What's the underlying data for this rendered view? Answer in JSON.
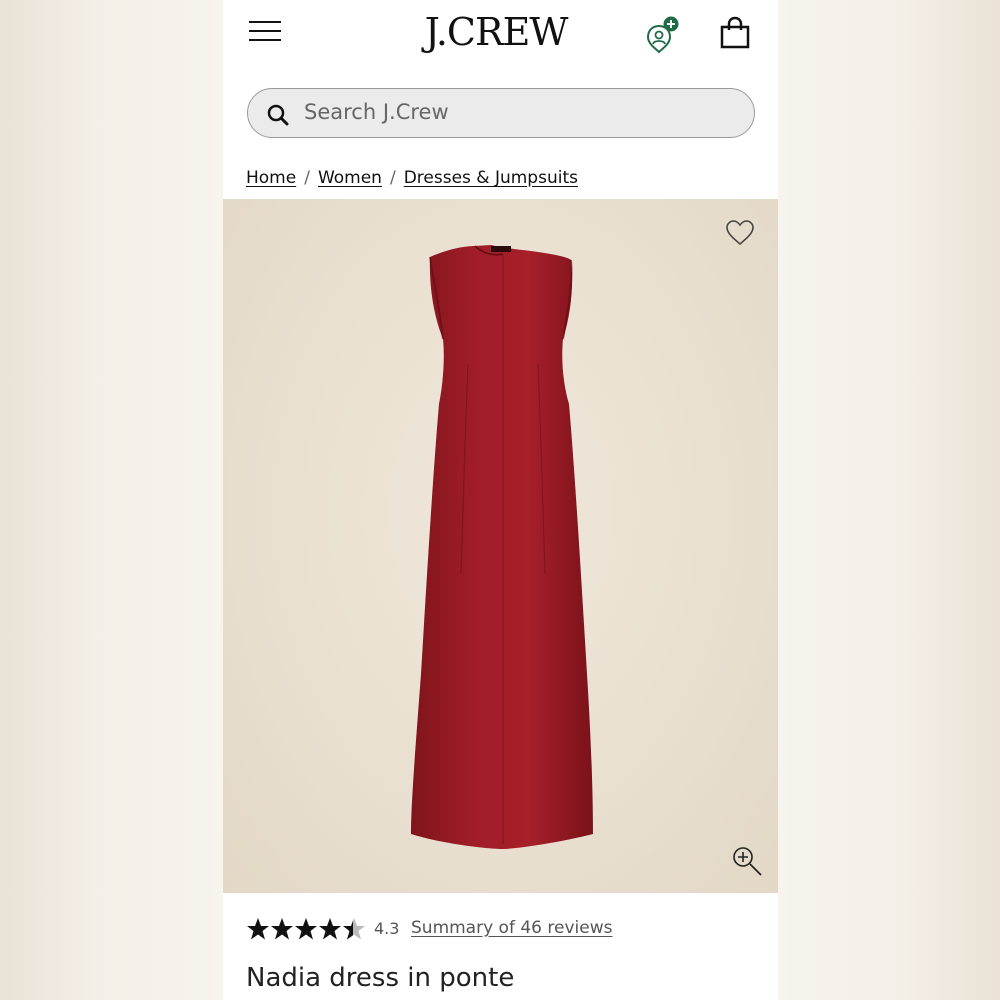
{
  "header": {
    "logo_text": "J.CREW",
    "menu_icon": "hamburger-menu-icon",
    "account_icon": "rewards-account-icon",
    "bag_icon": "shopping-bag-icon"
  },
  "search": {
    "placeholder": "Search J.Crew",
    "icon": "search-icon"
  },
  "breadcrumb": {
    "items": [
      "Home",
      "Women",
      "Dresses & Jumpsuits"
    ],
    "separator": "/"
  },
  "product": {
    "image_alt": "Nadia dress in ponte",
    "wishlist_icon": "heart-icon",
    "zoom_icon": "zoom-in-icon",
    "rating": 4.3,
    "rating_label": "4.3",
    "max_rating": 5,
    "reviews_link": "Summary of 46 reviews",
    "name": "Nadia dress in ponte",
    "dress_color": "#9e1b24"
  },
  "colors": {
    "account_badge": "#1f6b45",
    "hero_background": "#ebe3d6"
  }
}
